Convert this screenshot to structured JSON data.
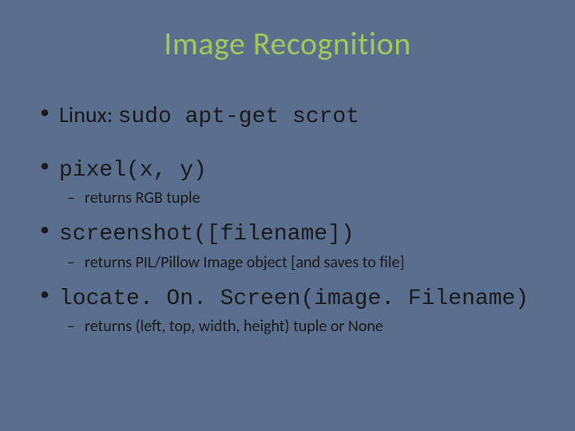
{
  "slide": {
    "title": "Image Recognition",
    "bullets": [
      {
        "intro": "Linux: ",
        "code": "sudo apt-get scrot",
        "sub": null
      },
      {
        "intro": "",
        "code": "pixel(x, y)",
        "sub": "returns RGB tuple"
      },
      {
        "intro": "",
        "code": "screenshot([filename])",
        "sub": "returns PIL/Pillow Image object [and saves to file]"
      },
      {
        "intro": "",
        "code": "locate. On. Screen(image. Filename)",
        "sub": "returns (left, top, width, height) tuple or None"
      }
    ]
  }
}
